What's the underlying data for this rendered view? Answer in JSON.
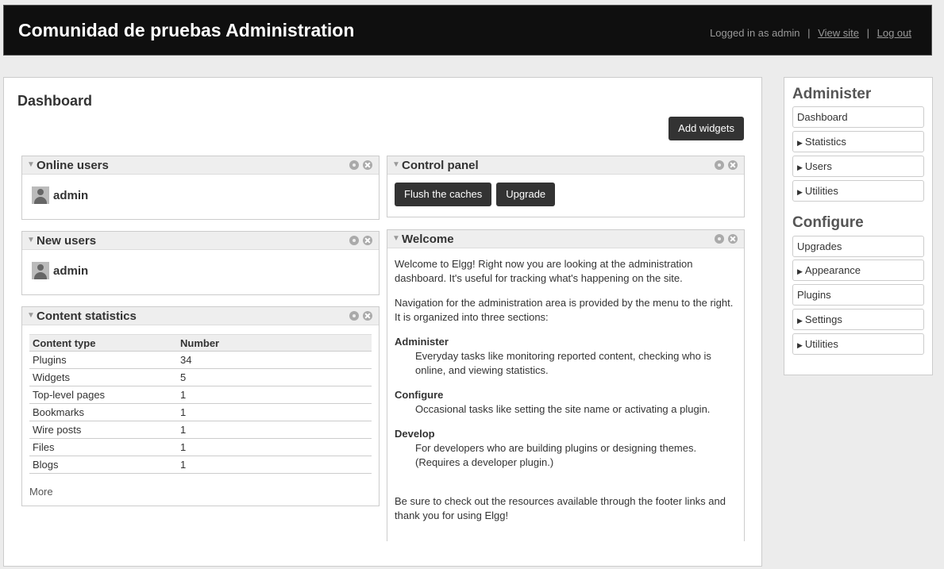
{
  "header": {
    "title": "Comunidad de pruebas Administration",
    "logged_in": "Logged in as admin",
    "sep": "|",
    "view_site": "View site",
    "log_out": "Log out"
  },
  "main": {
    "title": "Dashboard",
    "add_widgets": "Add widgets"
  },
  "widgets": {
    "online_users": {
      "title": "Online users",
      "user": "admin"
    },
    "new_users": {
      "title": "New users",
      "user": "admin"
    },
    "content_stats": {
      "title": "Content statistics",
      "col_type": "Content type",
      "col_number": "Number",
      "rows": [
        {
          "type": "Plugins",
          "number": "34"
        },
        {
          "type": "Widgets",
          "number": "5"
        },
        {
          "type": "Top-level pages",
          "number": "1"
        },
        {
          "type": "Bookmarks",
          "number": "1"
        },
        {
          "type": "Wire posts",
          "number": "1"
        },
        {
          "type": "Files",
          "number": "1"
        },
        {
          "type": "Blogs",
          "number": "1"
        }
      ],
      "more": "More"
    },
    "control_panel": {
      "title": "Control panel",
      "flush": "Flush the caches",
      "upgrade": "Upgrade"
    },
    "welcome": {
      "title": "Welcome",
      "p1": "Welcome to Elgg! Right now you are looking at the administration dashboard. It's useful for tracking what's happening on the site.",
      "p2": "Navigation for the administration area is provided by the menu to the right. It is organized into three sections:",
      "administer_t": "Administer",
      "administer_d": "Everyday tasks like monitoring reported content, checking who is online, and viewing statistics.",
      "configure_t": "Configure",
      "configure_d": "Occasional tasks like setting the site name or activating a plugin.",
      "develop_t": "Develop",
      "develop_d": "For developers who are building plugins or designing themes. (Requires a developer plugin.)",
      "p3": "Be sure to check out the resources available through the footer links and thank you for using Elgg!"
    }
  },
  "sidebar": {
    "administer": "Administer",
    "administer_items": [
      "Dashboard",
      "Statistics",
      "Users",
      "Utilities"
    ],
    "configure": "Configure",
    "configure_items": [
      "Upgrades",
      "Appearance",
      "Plugins",
      "Settings",
      "Utilities"
    ]
  }
}
